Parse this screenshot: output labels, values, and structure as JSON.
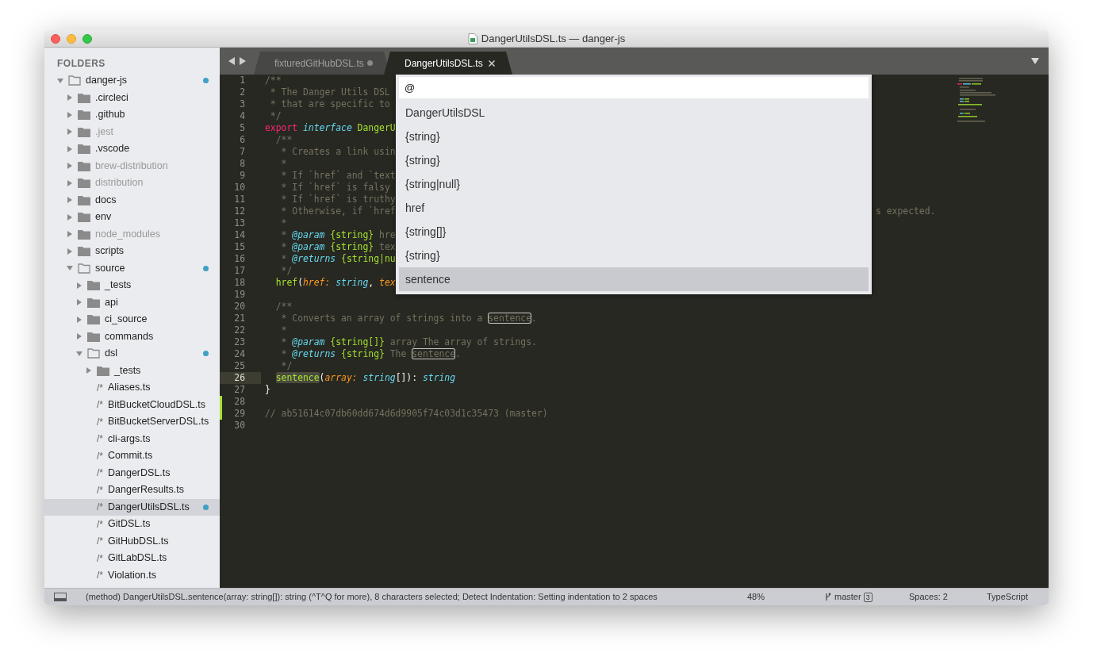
{
  "window": {
    "title": "DangerUtilsDSL.ts — danger-js"
  },
  "sidebar": {
    "header": "FOLDERS",
    "tree": [
      {
        "name": "danger-js",
        "kind": "folder",
        "expanded": true,
        "dimmed": false,
        "modified": true,
        "selected": false,
        "children": [
          {
            "name": ".circleci",
            "kind": "folder",
            "expanded": false,
            "dimmed": false,
            "modified": false,
            "selected": false
          },
          {
            "name": ".github",
            "kind": "folder",
            "expanded": false,
            "dimmed": false,
            "modified": false,
            "selected": false
          },
          {
            "name": ".jest",
            "kind": "folder",
            "expanded": false,
            "dimmed": true,
            "modified": false,
            "selected": false
          },
          {
            "name": ".vscode",
            "kind": "folder",
            "expanded": false,
            "dimmed": false,
            "modified": false,
            "selected": false
          },
          {
            "name": "brew-distribution",
            "kind": "folder",
            "expanded": false,
            "dimmed": true,
            "modified": false,
            "selected": false
          },
          {
            "name": "distribution",
            "kind": "folder",
            "expanded": false,
            "dimmed": true,
            "modified": false,
            "selected": false
          },
          {
            "name": "docs",
            "kind": "folder",
            "expanded": false,
            "dimmed": false,
            "modified": false,
            "selected": false
          },
          {
            "name": "env",
            "kind": "folder",
            "expanded": false,
            "dimmed": false,
            "modified": false,
            "selected": false
          },
          {
            "name": "node_modules",
            "kind": "folder",
            "expanded": false,
            "dimmed": true,
            "modified": false,
            "selected": false
          },
          {
            "name": "scripts",
            "kind": "folder",
            "expanded": false,
            "dimmed": false,
            "modified": false,
            "selected": false
          },
          {
            "name": "source",
            "kind": "folder",
            "expanded": true,
            "dimmed": false,
            "modified": true,
            "selected": false,
            "children": [
              {
                "name": "_tests",
                "kind": "folder",
                "expanded": false,
                "dimmed": false,
                "modified": false,
                "selected": false
              },
              {
                "name": "api",
                "kind": "folder",
                "expanded": false,
                "dimmed": false,
                "modified": false,
                "selected": false
              },
              {
                "name": "ci_source",
                "kind": "folder",
                "expanded": false,
                "dimmed": false,
                "modified": false,
                "selected": false
              },
              {
                "name": "commands",
                "kind": "folder",
                "expanded": false,
                "dimmed": false,
                "modified": false,
                "selected": false
              },
              {
                "name": "dsl",
                "kind": "folder",
                "expanded": true,
                "dimmed": false,
                "modified": true,
                "selected": false,
                "children": [
                  {
                    "name": "_tests",
                    "kind": "folder",
                    "expanded": false,
                    "dimmed": false,
                    "modified": false,
                    "selected": false
                  },
                  {
                    "name": "Aliases.ts",
                    "kind": "file",
                    "icon_text": "/*",
                    "dimmed": false,
                    "modified": false,
                    "selected": false
                  },
                  {
                    "name": "BitBucketCloudDSL.ts",
                    "kind": "file",
                    "icon_text": "/*",
                    "dimmed": false,
                    "modified": false,
                    "selected": false
                  },
                  {
                    "name": "BitBucketServerDSL.ts",
                    "kind": "file",
                    "icon_text": "/*",
                    "dimmed": false,
                    "modified": false,
                    "selected": false
                  },
                  {
                    "name": "cli-args.ts",
                    "kind": "file",
                    "icon_text": "/*",
                    "dimmed": false,
                    "modified": false,
                    "selected": false
                  },
                  {
                    "name": "Commit.ts",
                    "kind": "file",
                    "icon_text": "/*",
                    "dimmed": false,
                    "modified": false,
                    "selected": false
                  },
                  {
                    "name": "DangerDSL.ts",
                    "kind": "file",
                    "icon_text": "/*",
                    "dimmed": false,
                    "modified": false,
                    "selected": false
                  },
                  {
                    "name": "DangerResults.ts",
                    "kind": "file",
                    "icon_text": "/*",
                    "dimmed": false,
                    "modified": false,
                    "selected": false
                  },
                  {
                    "name": "DangerUtilsDSL.ts",
                    "kind": "file",
                    "icon_text": "/*",
                    "dimmed": false,
                    "modified": true,
                    "selected": true
                  },
                  {
                    "name": "GitDSL.ts",
                    "kind": "file",
                    "icon_text": "/*",
                    "dimmed": false,
                    "modified": false,
                    "selected": false
                  },
                  {
                    "name": "GitHubDSL.ts",
                    "kind": "file",
                    "icon_text": "/*",
                    "dimmed": false,
                    "modified": false,
                    "selected": false
                  },
                  {
                    "name": "GitLabDSL.ts",
                    "kind": "file",
                    "icon_text": "/*",
                    "dimmed": false,
                    "modified": false,
                    "selected": false
                  },
                  {
                    "name": "Violation.ts",
                    "kind": "file",
                    "icon_text": "/*",
                    "dimmed": false,
                    "modified": false,
                    "selected": false
                  }
                ]
              }
            ]
          }
        ]
      }
    ]
  },
  "tabs": [
    {
      "label": "fixturedGitHubDSL.ts",
      "selected": false,
      "dirty": true
    },
    {
      "label": "DangerUtilsDSL.ts",
      "selected": true,
      "dirty": false
    }
  ],
  "editor": {
    "lines": [
      {
        "number": "1",
        "current": false,
        "modified": false,
        "tokens": [
          {
            "kind": "comment",
            "text": "/**"
          }
        ]
      },
      {
        "number": "2",
        "current": false,
        "modified": false,
        "tokens": [
          {
            "kind": "comment",
            "text": " * The Danger Utils DSL"
          }
        ]
      },
      {
        "number": "3",
        "current": false,
        "modified": false,
        "tokens": [
          {
            "kind": "comment",
            "text": " * that are specific to"
          }
        ]
      },
      {
        "number": "4",
        "current": false,
        "modified": false,
        "tokens": [
          {
            "kind": "comment",
            "text": " */"
          }
        ]
      },
      {
        "number": "5",
        "current": false,
        "modified": false,
        "tokens": [
          {
            "kind": "keyword",
            "text": "export "
          },
          {
            "kind": "storage",
            "text": "interface "
          },
          {
            "kind": "entity",
            "text": "DangerU"
          }
        ]
      },
      {
        "number": "6",
        "current": false,
        "modified": false,
        "tokens": [
          {
            "kind": "comment",
            "text": "  /**"
          }
        ]
      },
      {
        "number": "7",
        "current": false,
        "modified": false,
        "tokens": [
          {
            "kind": "comment",
            "text": "   * Creates a link usin"
          }
        ]
      },
      {
        "number": "8",
        "current": false,
        "modified": false,
        "tokens": [
          {
            "kind": "comment",
            "text": "   *"
          }
        ]
      },
      {
        "number": "9",
        "current": false,
        "modified": false,
        "tokens": [
          {
            "kind": "comment",
            "text": "   * If `href` and `text"
          }
        ]
      },
      {
        "number": "10",
        "current": false,
        "modified": false,
        "tokens": [
          {
            "kind": "comment",
            "text": "   * If `href` is falsy"
          }
        ]
      },
      {
        "number": "11",
        "current": false,
        "modified": false,
        "tokens": [
          {
            "kind": "comment",
            "text": "   * If `href` is truthy"
          }
        ]
      },
      {
        "number": "12",
        "current": false,
        "modified": false,
        "tokens": [
          {
            "kind": "comment",
            "text": "   * Otherwise, if `href"
          }
        ],
        "tail": "s expected."
      },
      {
        "number": "13",
        "current": false,
        "modified": false,
        "tokens": [
          {
            "kind": "comment",
            "text": "   *"
          }
        ]
      },
      {
        "number": "14",
        "current": false,
        "modified": false,
        "tokens": [
          {
            "kind": "comment",
            "text": "   * "
          },
          {
            "kind": "tag",
            "text": "@param"
          },
          {
            "kind": "doc-type",
            "text": " {string}"
          },
          {
            "kind": "comment",
            "text": " hre"
          }
        ]
      },
      {
        "number": "15",
        "current": false,
        "modified": false,
        "tokens": [
          {
            "kind": "comment",
            "text": "   * "
          },
          {
            "kind": "tag",
            "text": "@param"
          },
          {
            "kind": "doc-type",
            "text": " {string}"
          },
          {
            "kind": "comment",
            "text": " tex"
          }
        ]
      },
      {
        "number": "16",
        "current": false,
        "modified": false,
        "tokens": [
          {
            "kind": "comment",
            "text": "   * "
          },
          {
            "kind": "tag",
            "text": "@returns"
          },
          {
            "kind": "doc-type",
            "text": " {string|nu"
          }
        ]
      },
      {
        "number": "17",
        "current": false,
        "modified": false,
        "tokens": [
          {
            "kind": "comment",
            "text": "   */"
          }
        ]
      },
      {
        "number": "18",
        "current": false,
        "modified": false,
        "tokens": [
          {
            "kind": "entity",
            "text": "  href"
          },
          {
            "kind": "plain",
            "text": "("
          },
          {
            "kind": "param",
            "text": "href:"
          },
          {
            "kind": "type",
            "text": " string"
          },
          {
            "kind": "plain",
            "text": ", "
          },
          {
            "kind": "param",
            "text": "tex"
          }
        ]
      },
      {
        "number": "19",
        "current": false,
        "modified": false
      },
      {
        "number": "20",
        "current": false,
        "modified": false,
        "tokens": [
          {
            "kind": "comment",
            "text": "  /**"
          }
        ]
      },
      {
        "number": "21",
        "current": false,
        "modified": false,
        "tokens": [
          {
            "kind": "comment",
            "text": "   * Converts an array of strings into a "
          },
          {
            "kind": "match",
            "text": "sentence"
          },
          {
            "kind": "comment",
            "text": "."
          }
        ]
      },
      {
        "number": "22",
        "current": false,
        "modified": false,
        "tokens": [
          {
            "kind": "comment",
            "text": "   *"
          }
        ]
      },
      {
        "number": "23",
        "current": false,
        "modified": false,
        "tokens": [
          {
            "kind": "comment",
            "text": "   * "
          },
          {
            "kind": "tag",
            "text": "@param"
          },
          {
            "kind": "doc-type",
            "text": " {string[]}"
          },
          {
            "kind": "comment",
            "text": " array The array of strings."
          }
        ]
      },
      {
        "number": "24",
        "current": false,
        "modified": false,
        "tokens": [
          {
            "kind": "comment",
            "text": "   * "
          },
          {
            "kind": "tag",
            "text": "@returns"
          },
          {
            "kind": "doc-type",
            "text": " {string}"
          },
          {
            "kind": "comment",
            "text": " The "
          },
          {
            "kind": "match",
            "text": "sentence"
          },
          {
            "kind": "comment",
            "text": "."
          }
        ]
      },
      {
        "number": "25",
        "current": false,
        "modified": false,
        "tokens": [
          {
            "kind": "comment",
            "text": "   */"
          }
        ]
      },
      {
        "number": "26",
        "current": true,
        "modified": false,
        "tokens": [
          {
            "kind": "entity-selected",
            "text": "  sentence"
          },
          {
            "kind": "plain",
            "text": "("
          },
          {
            "kind": "param",
            "text": "array:"
          },
          {
            "kind": "type",
            "text": " string"
          },
          {
            "kind": "plain",
            "text": "[]): "
          },
          {
            "kind": "type",
            "text": "string"
          }
        ]
      },
      {
        "number": "27",
        "current": false,
        "modified": false,
        "tokens": [
          {
            "kind": "plain",
            "text": "}"
          }
        ]
      },
      {
        "number": "28",
        "current": false,
        "modified": true
      },
      {
        "number": "29",
        "current": false,
        "modified": true,
        "tokens": [
          {
            "kind": "comment",
            "text": "// ab51614c07db60dd674d6d9905f74c03d1c35473 (master)"
          }
        ]
      },
      {
        "number": "30",
        "current": false,
        "modified": false
      }
    ]
  },
  "symbol_popup": {
    "query": "@",
    "items": [
      {
        "label": "DangerUtilsDSL",
        "selected": false
      },
      {
        "label": "{string}",
        "selected": false
      },
      {
        "label": "{string}",
        "selected": false
      },
      {
        "label": "{string|null}",
        "selected": false
      },
      {
        "label": "href",
        "selected": false
      },
      {
        "label": "{string[]}",
        "selected": false
      },
      {
        "label": "{string}",
        "selected": false
      },
      {
        "label": "sentence",
        "selected": true
      }
    ]
  },
  "status_bar": {
    "message": "(method) DangerUtilsDSL.sentence(array: string[]): string (^T^Q for more), 8 characters selected; Detect Indentation: Setting indentation to 2 spaces",
    "zoom": "48%",
    "branch": "master",
    "branch_badge": "3",
    "indentation": "Spaces: 2",
    "syntax": "TypeScript"
  }
}
